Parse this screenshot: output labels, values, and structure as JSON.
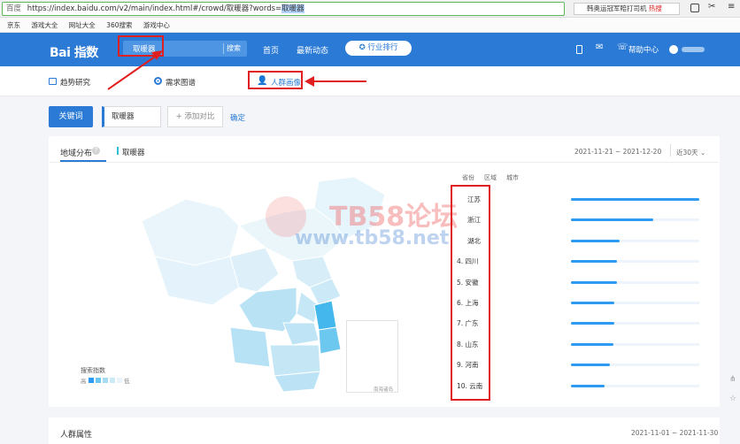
{
  "browser": {
    "site_label": "百度",
    "url_prefix": "https://index.baidu.com/v2/main/index.html#/crowd/取暖器?words=",
    "url_selected": "取暖器",
    "search_hint": "韩奥运冠军賠打司机",
    "hot_label": "热搜",
    "bookmarks": [
      "京东",
      "游戏大全",
      "网址大全",
      "360搜索",
      "游戏中心"
    ]
  },
  "header": {
    "logo_text": "Bai 指数",
    "search_value": "取暖器",
    "search_button": "搜索",
    "nav": [
      "首页",
      "最新动态"
    ],
    "ranking_pill": "行业排行",
    "help": "帮助中心"
  },
  "tabs": {
    "trend": "趋势研究",
    "demand": "需求图谱",
    "crowd": "人群画像"
  },
  "filter": {
    "keyword_button": "关键词",
    "keyword_value": "取暖器",
    "add_compare": "+ 添加对比",
    "confirm": "确定"
  },
  "region": {
    "title": "地域分布",
    "keyword": "取暖器",
    "date_range": "2021-11-21 ~ 2021-12-20",
    "period": "近30天",
    "subtabs": [
      "省份",
      "区域",
      "城市"
    ],
    "legend_title": "搜索指数",
    "legend_high": "高",
    "legend_low": "低",
    "map_inset_label": "南海诸岛",
    "ranks": [
      {
        "label": "江苏",
        "value": 1.0
      },
      {
        "label": "浙江",
        "value": 0.64
      },
      {
        "label": "湖北",
        "value": 0.38
      },
      {
        "label": "4.  四川",
        "value": 0.36
      },
      {
        "label": "5.  安徽",
        "value": 0.36
      },
      {
        "label": "6.  上海",
        "value": 0.34
      },
      {
        "label": "7.  广东",
        "value": 0.34
      },
      {
        "label": "8.  山东",
        "value": 0.33
      },
      {
        "label": "9.  河南",
        "value": 0.3
      },
      {
        "label": "10. 云南",
        "value": 0.26
      }
    ]
  },
  "crowd": {
    "title": "人群属性",
    "date_range": "2021-11-01 ~ 2021-11-30"
  },
  "watermark": {
    "line1": "TB58论坛",
    "line2": "www.tb58.net"
  },
  "colors": {
    "brand": "#2b7bd6",
    "bar": "#2d9af3",
    "annotation": "#e02020"
  }
}
